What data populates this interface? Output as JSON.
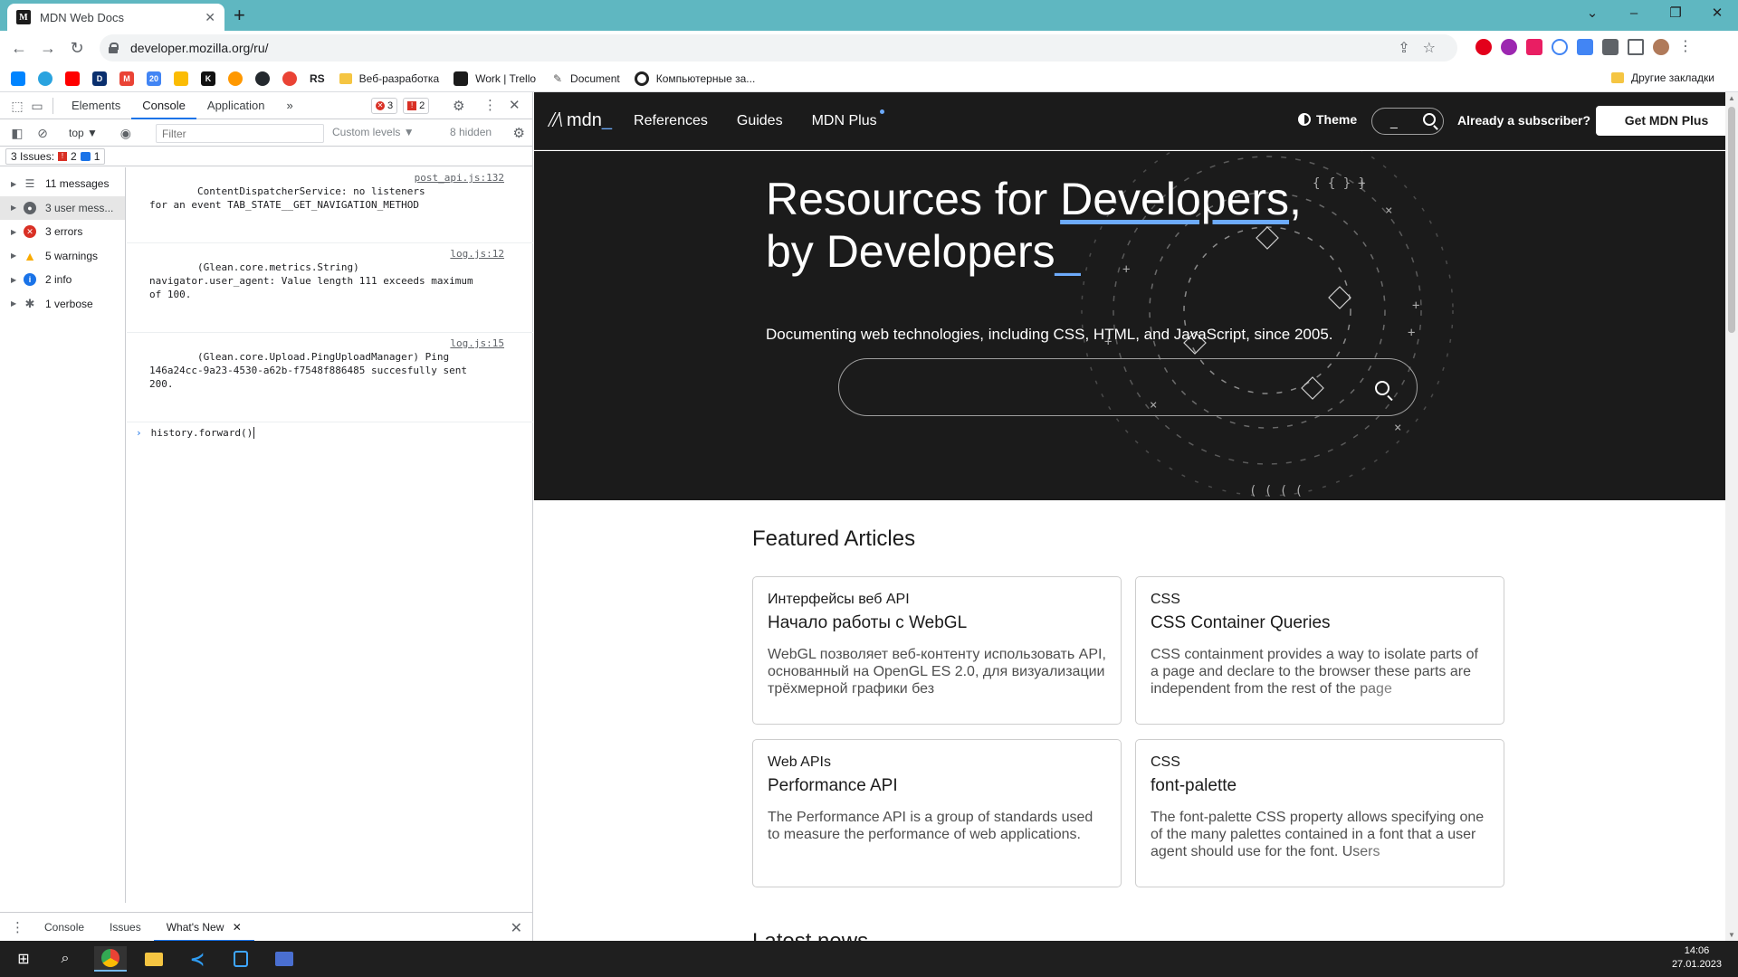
{
  "browser": {
    "tab_title": "MDN Web Docs",
    "tab_favicon": "M",
    "url": "developer.mozilla.org/ru/",
    "bookmarks": [
      {
        "label": "Веб-разработка",
        "icon": "folder-icon"
      },
      {
        "label": "Work | Trello",
        "icon": "trello-icon"
      },
      {
        "label": "Document",
        "icon": "document-icon"
      },
      {
        "label": "Компьютерные за...",
        "icon": "circle-icon"
      }
    ],
    "bookmark_icons": [
      "bm-messenger",
      "bm-telegram",
      "bm-youtube",
      "bm-d",
      "bm-gmail",
      "bm-calendar",
      "bm-keep",
      "bm-k",
      "bm-orange",
      "bm-github",
      "bm-google"
    ],
    "bookmark_rs": "RS",
    "other_bookmarks": "Другие закладки"
  },
  "devtools": {
    "tabs": [
      "Elements",
      "Console",
      "Application"
    ],
    "active_tab": "Console",
    "more_tabs": "»",
    "error_badge": "3",
    "warning_badge": "2",
    "context": "top",
    "filter_placeholder": "Filter",
    "levels": "Custom levels ▼",
    "hidden": "8 hidden",
    "issues_label": "3 Issues:",
    "issues_errors": "2",
    "issues_info": "1",
    "sidebar": [
      {
        "label": "11 messages",
        "icon": "list-icon",
        "color": "#5f6368"
      },
      {
        "label": "3 user mess...",
        "icon": "user-icon",
        "color": "#5f6368"
      },
      {
        "label": "3 errors",
        "icon": "error-icon",
        "color": "#d93025"
      },
      {
        "label": "5 warnings",
        "icon": "warning-icon",
        "color": "#f9ab00"
      },
      {
        "label": "2 info",
        "icon": "info-icon",
        "color": "#1a73e8"
      },
      {
        "label": "1 verbose",
        "icon": "bug-icon",
        "color": "#5f6368"
      }
    ],
    "messages": [
      {
        "text": "ContentDispatcherService: no listeners\nfor an event TAB_STATE__GET_NAVIGATION_METHOD",
        "src": "post_api.js:132"
      },
      {
        "text": "(Glean.core.metrics.String)\nnavigator.user_agent: Value length 111 exceeds maximum\nof 100.",
        "src": "log.js:12"
      },
      {
        "text": "(Glean.core.Upload.PingUploadManager) Ping\n146a24cc-9a23-4530-a62b-f7548f886485 succesfully sent\n200.",
        "src": "log.js:15"
      }
    ],
    "prompt": "history.forward()",
    "drawer_tabs": [
      "Console",
      "Issues",
      "What's New"
    ],
    "drawer_active": "What's New"
  },
  "mdn": {
    "logo": "mdn",
    "nav": [
      "References",
      "Guides",
      "MDN Plus"
    ],
    "theme": "Theme",
    "search_cursor": "_",
    "subscriber": "Already a subscriber?",
    "get_plus": "Get MDN Plus",
    "hero_line1_a": "Resources for ",
    "hero_line1_b": "Developers",
    "hero_line1_c": ",",
    "hero_line2": "by Developers",
    "hero_underscore": "_",
    "hero_sub": "Documenting web technologies, including CSS, HTML, and JavaScript, since 2005.",
    "featured_title": "Featured Articles",
    "cards": [
      {
        "cat": "Интерфейсы веб API",
        "title": "Начало работы с WebGL",
        "desc": "WebGL позволяет веб-контенту использовать API, основанный на OpenGL ES 2.0, для визуализации трёхмерной графики без"
      },
      {
        "cat": "CSS",
        "title": "CSS Container Queries",
        "desc": "CSS containment provides a way to isolate parts of a page and declare to the browser these parts are independent from the rest of the page"
      },
      {
        "cat": "Web APIs",
        "title": "Performance API",
        "desc": "The Performance API is a group of standards used to measure the performance of web applications."
      },
      {
        "cat": "CSS",
        "title": "font-palette",
        "desc": "The font-palette CSS property allows specifying one of the many palettes contained in a font that a user agent should use for the font. Users"
      }
    ],
    "latest_title": "Latest news"
  },
  "taskbar": {
    "time": "14:06",
    "date": "27.01.2023"
  }
}
